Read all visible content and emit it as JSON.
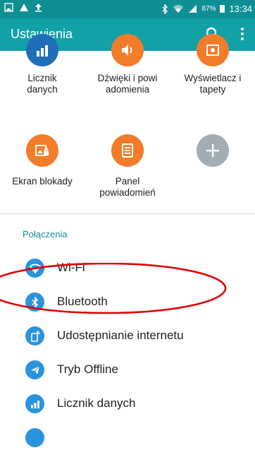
{
  "status_bar": {
    "battery_percent": "87%",
    "time": "13:34"
  },
  "app_bar": {
    "title": "Ustawienia"
  },
  "grid": {
    "row1": [
      {
        "label": "Licznik danych",
        "icon": "data-usage-icon",
        "color": "#1e7ec8"
      },
      {
        "label": "Dźwięki i powi adomienia",
        "icon": "sound-icon",
        "color": "#f27c2a"
      },
      {
        "label": "Wyświetlacz i tapety",
        "icon": "display-icon",
        "color": "#f27c2a"
      }
    ],
    "row2": [
      {
        "label": "Ekran blokady",
        "icon": "lock-screen-icon",
        "color": "#f27c2a"
      },
      {
        "label": "Panel powiadomień",
        "icon": "notification-panel-icon",
        "color": "#f27c2a"
      },
      {
        "label": "",
        "icon": "add-icon",
        "color": "#a2adb4"
      }
    ]
  },
  "section": {
    "header": "Połączenia"
  },
  "list": [
    {
      "label": "Wi-Fi",
      "icon": "wifi-icon"
    },
    {
      "label": "Bluetooth",
      "icon": "bluetooth-icon"
    },
    {
      "label": "Udostępnianie internetu",
      "icon": "tethering-icon"
    },
    {
      "label": "Tryb Offline",
      "icon": "airplane-icon"
    },
    {
      "label": "Licznik danych",
      "icon": "data-usage-icon"
    }
  ],
  "colors": {
    "status_bar": "#0f8f94",
    "app_bar": "#12a1a6",
    "accent": "#1a8f95",
    "list_icon": "#2a93dd",
    "annotation": "#e00000"
  }
}
